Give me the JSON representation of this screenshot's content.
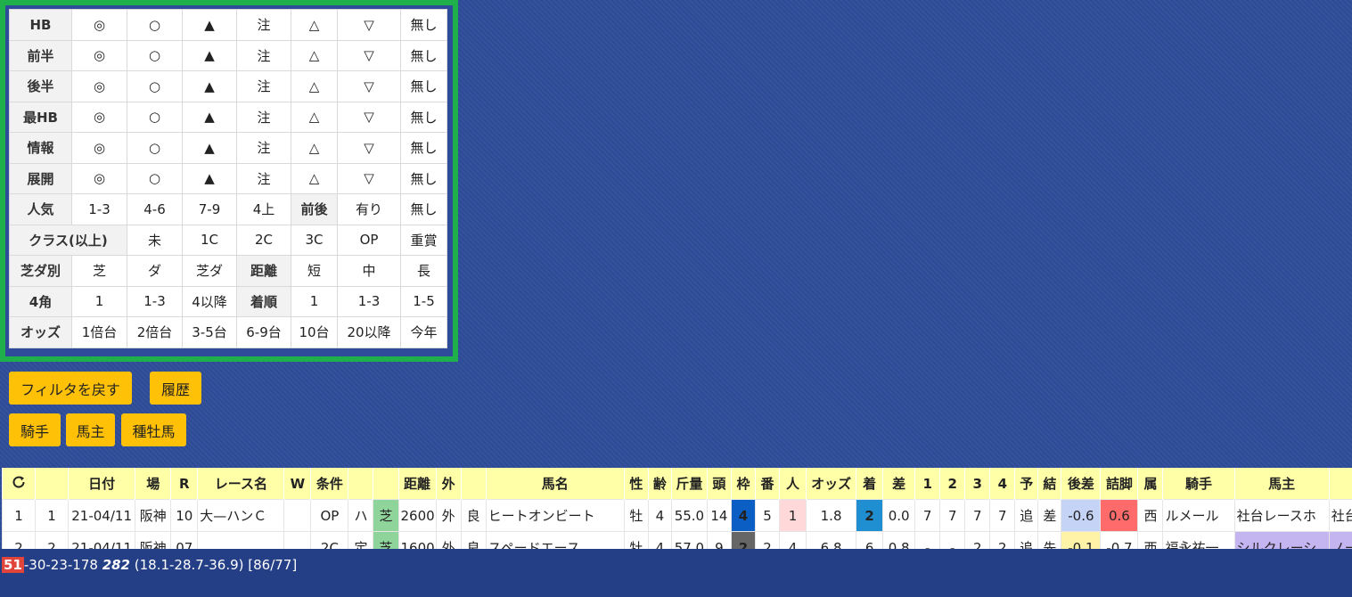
{
  "filter": {
    "rows": [
      {
        "label": "HB",
        "cells": [
          "◎",
          "○",
          "▲",
          "注",
          "△",
          "▽",
          "無し"
        ]
      },
      {
        "label": "前半",
        "cells": [
          "◎",
          "○",
          "▲",
          "注",
          "△",
          "▽",
          "無し"
        ]
      },
      {
        "label": "後半",
        "cells": [
          "◎",
          "○",
          "▲",
          "注",
          "△",
          "▽",
          "無し"
        ]
      },
      {
        "label": "最HB",
        "cells": [
          "◎",
          "○",
          "▲",
          "注",
          "△",
          "▽",
          "無し"
        ]
      },
      {
        "label": "情報",
        "cells": [
          "◎",
          "○",
          "▲",
          "注",
          "△",
          "▽",
          "無し"
        ]
      },
      {
        "label": "展開",
        "cells": [
          "◎",
          "○",
          "▲",
          "注",
          "△",
          "▽",
          "無し"
        ]
      }
    ],
    "ninki": {
      "label": "人気",
      "cells": [
        "1-3",
        "4-6",
        "7-9",
        "4上"
      ],
      "label2": "前後",
      "cells2": [
        "有り",
        "無し"
      ]
    },
    "class": {
      "label": "クラス(以上)",
      "cells": [
        "未",
        "1C",
        "2C",
        "3C",
        "OP",
        "重賞"
      ]
    },
    "shibada": {
      "label": "芝ダ別",
      "cells": [
        "芝",
        "ダ",
        "芝ダ"
      ],
      "label2": "距離",
      "cells2": [
        "短",
        "中",
        "長"
      ]
    },
    "kado": {
      "label": "4角",
      "cells": [
        "1",
        "1-3",
        "4以降"
      ],
      "label2": "着順",
      "cells2": [
        "1",
        "1-3",
        "1-5"
      ]
    },
    "odds": {
      "label": "オッズ",
      "cells": [
        "1倍台",
        "2倍台",
        "3-5台",
        "6-9台",
        "10台",
        "20以降",
        "今年"
      ]
    }
  },
  "buttons": {
    "reset": "フィルタを戻す",
    "history": "履歴",
    "jockey": "騎手",
    "owner": "馬主",
    "sire": "種牡馬"
  },
  "table": {
    "headers": [
      "日付",
      "場",
      "R",
      "レース名",
      "W",
      "条件",
      "",
      "距離",
      "外",
      "",
      "馬名",
      "性",
      "齢",
      "斤量",
      "頭",
      "枠",
      "番",
      "人",
      "オッズ",
      "着",
      "差",
      "1",
      "2",
      "3",
      "4",
      "予",
      "結",
      "後差",
      "詰脚",
      "属",
      "騎手",
      "馬主",
      ""
    ],
    "rows": [
      [
        "1",
        "1",
        "21-04/11",
        "阪神",
        "10",
        "大—ハンＣ",
        "",
        "OP",
        "ハ",
        "芝",
        "2600",
        "外",
        "良",
        "ヒートオンビート",
        "牡",
        "4",
        "55.0",
        "14",
        "4",
        "5",
        "1",
        "1.8",
        "2",
        "0.0",
        "7",
        "7",
        "7",
        "7",
        "追",
        "差",
        "-0.6",
        "0.6",
        "西",
        "ルメール",
        "社台レースホ",
        "社台"
      ],
      [
        "2",
        "2",
        "21-04/11",
        "阪神",
        "07",
        "",
        "",
        "2C",
        "定",
        "芝",
        "1600",
        "外",
        "良",
        "スペードエース",
        "牡",
        "4",
        "57.0",
        "9",
        "2",
        "2",
        "4",
        "6.8",
        "6",
        "0.8",
        "-",
        "-",
        "2",
        "2",
        "追",
        "先",
        "-0.1",
        "-0.7",
        "西",
        "福永祐一",
        "シルクレーシ",
        "ノー"
      ]
    ]
  },
  "status": {
    "badge": "51",
    "text": "-30-23-178 ",
    "bold": "282",
    "rest": " (18.1-28.7-36.9) [86/77]"
  }
}
